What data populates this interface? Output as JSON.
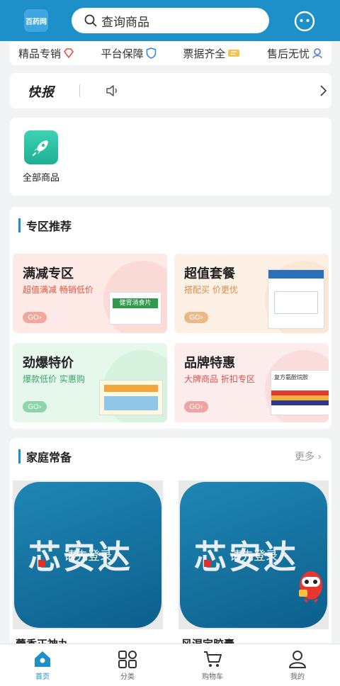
{
  "header": {
    "logo_text": "百药网",
    "search_placeholder": "查询商品"
  },
  "promises": [
    {
      "label": "精品专销",
      "icon": "diamond-icon"
    },
    {
      "label": "平台保障",
      "icon": "shield-icon"
    },
    {
      "label": "票据齐全",
      "icon": "ticket-icon"
    },
    {
      "label": "售后无忧",
      "icon": "service-icon"
    }
  ],
  "news": {
    "title": "快报"
  },
  "categories": [
    {
      "label": "全部商品",
      "icon": "rocket-icon"
    }
  ],
  "zones_section": {
    "title": "专区推荐"
  },
  "zones": [
    {
      "title": "满减专区",
      "subtitle": "超值满减  畅销低价",
      "go": "GO›",
      "bg": "#fde9e6",
      "accent": "#e0573e",
      "product_text": "健胃消食片"
    },
    {
      "title": "超值套餐",
      "subtitle": "搭配买  价更优",
      "go": "GO›",
      "bg": "#fdf0e4",
      "accent": "#d98c45",
      "product_text": ""
    },
    {
      "title": "劲爆特价",
      "subtitle": "爆款低价  实惠购",
      "go": "GO›",
      "bg": "#e6f7ec",
      "accent": "#3aa66a",
      "product_text": ""
    },
    {
      "title": "品牌特惠",
      "subtitle": "大牌商品  折扣专区",
      "go": "GO›",
      "bg": "#fdecec",
      "accent": "#d9534f",
      "product_text": "复方氨酚烷胺"
    }
  ],
  "family_section": {
    "title": "家庭常备",
    "more": "更多 ›"
  },
  "products": [
    {
      "brand_text": "芯安达",
      "login_text": "请先登录",
      "name": "藿香正神丸"
    },
    {
      "brand_text": "芯安达",
      "login_text": "请先登录",
      "name": "风湿定胶囊"
    }
  ],
  "tabbar": [
    {
      "label": "首页",
      "icon": "home-icon",
      "active": true
    },
    {
      "label": "分类",
      "icon": "category-icon",
      "active": false
    },
    {
      "label": "购物车",
      "icon": "cart-icon",
      "active": false
    },
    {
      "label": "我的",
      "icon": "user-icon",
      "active": false
    }
  ],
  "colors": {
    "brand": "#1d8fc9",
    "background": "#f2f3f5"
  }
}
